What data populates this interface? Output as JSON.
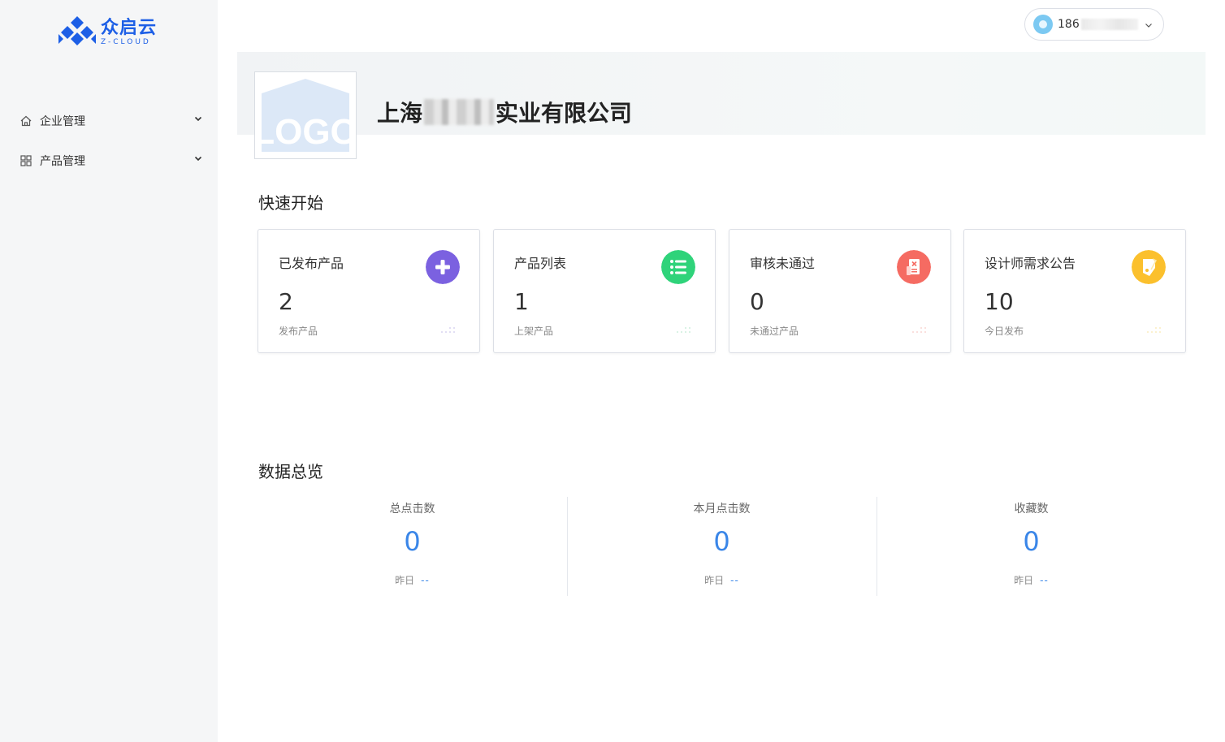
{
  "brand": {
    "name_cn": "众启云",
    "name_en": "Z-CLOUD",
    "color": "#1d5fe6"
  },
  "sidebar": {
    "items": [
      {
        "label": "企业管理",
        "icon": "home-icon"
      },
      {
        "label": "产品管理",
        "icon": "grid-icon"
      }
    ]
  },
  "header": {
    "user_phone": "186"
  },
  "company": {
    "logo_text": "LOGO",
    "name_prefix": "上海",
    "name_suffix": "实业有限公司"
  },
  "quick_start": {
    "title": "快速开始",
    "cards": [
      {
        "title": "已发布产品",
        "value": "2",
        "sub": "发布产品",
        "icon": "plus-icon",
        "color": "#7b61e0"
      },
      {
        "title": "产品列表",
        "value": "1",
        "sub": "上架产品",
        "icon": "list-icon",
        "color": "#2fd37a"
      },
      {
        "title": "审核未通过",
        "value": "0",
        "sub": "未通过产品",
        "icon": "rejected-doc-icon",
        "color": "#f56b62"
      },
      {
        "title": "设计师需求公告",
        "value": "10",
        "sub": "今日发布",
        "icon": "tag-icon",
        "color": "#fbc02d"
      }
    ]
  },
  "overview": {
    "title": "数据总览",
    "stats": [
      {
        "label": "总点击数",
        "value": "0",
        "yesterday_label": "昨日",
        "yesterday_value": "--"
      },
      {
        "label": "本月点击数",
        "value": "0",
        "yesterday_label": "昨日",
        "yesterday_value": "--"
      },
      {
        "label": "收藏数",
        "value": "0",
        "yesterday_label": "昨日",
        "yesterday_value": "--"
      }
    ],
    "accent": "#3a86e8"
  }
}
